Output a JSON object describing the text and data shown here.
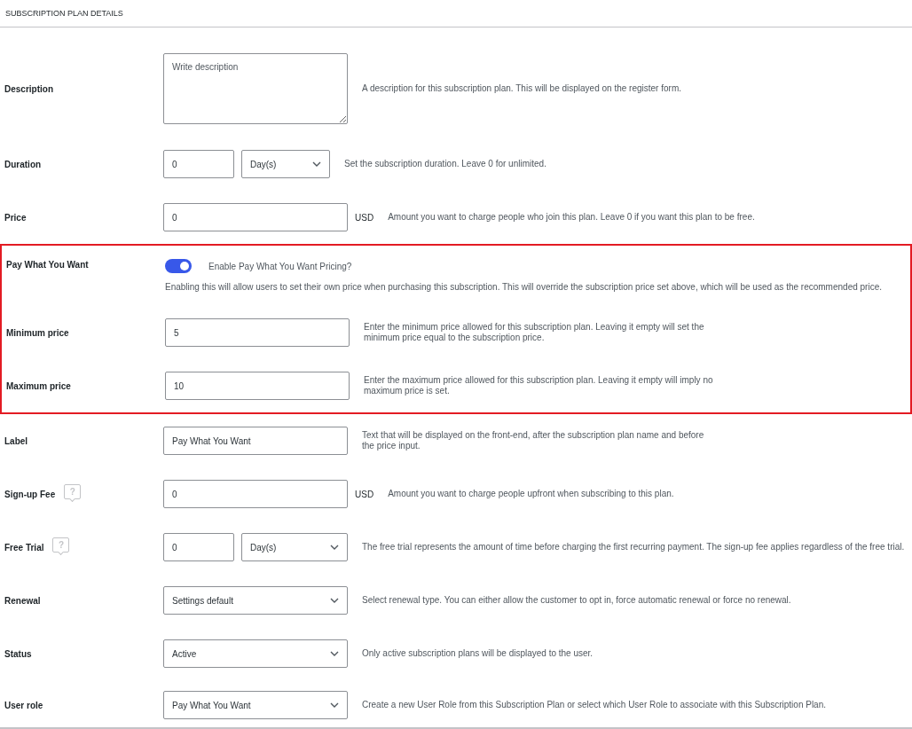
{
  "title": "SUBSCRIPTION PLAN DETAILS",
  "sections": [
    {
      "highlighted": false,
      "rows": [
        {
          "kind": "textarea",
          "label": "Description",
          "placeholder": "Write description",
          "help": "A description for this subscription plan. This will be displayed on the register form."
        },
        {
          "kind": "number_select",
          "label": "Duration",
          "value": "0",
          "select": "Day(s)",
          "help": "Set the subscription duration. Leave 0 for unlimited."
        },
        {
          "kind": "money",
          "label": "Price",
          "value": "0",
          "unit": "USD",
          "help": "Amount you want to charge people who join this plan. Leave 0 if you want this plan to be free."
        }
      ]
    },
    {
      "highlighted": true,
      "rows": [
        {
          "kind": "toggle",
          "label": "Pay What You Want",
          "on": true,
          "toggle_label": "Enable Pay What You Want Pricing?",
          "help": "Enabling this will allow users to set their own price when purchasing this subscription. This will override the subscription price set above, which will be used as the recommended price."
        },
        {
          "kind": "text",
          "label": "Minimum price",
          "value": "5",
          "help": "Enter the minimum price allowed for this subscription plan. Leaving it empty will set the minimum price equal to the subscription price."
        },
        {
          "kind": "text",
          "label": "Maximum price",
          "value": "10",
          "help": "Enter the maximum price allowed for this subscription plan. Leaving it empty will imply no maximum price is set."
        }
      ]
    },
    {
      "highlighted": false,
      "rows": [
        {
          "kind": "text",
          "label": "Label",
          "value": "Pay What You Want",
          "help": "Text that will be displayed on the front-end, after the subscription plan name and before the price input."
        },
        {
          "kind": "money",
          "label": "Sign-up Fee",
          "help_icon": "?",
          "value": "0",
          "unit": "USD",
          "help": "Amount you want to charge people upfront when subscribing to this plan."
        },
        {
          "kind": "number_select",
          "label": "Free Trial",
          "help_icon": "?",
          "value": "0",
          "select": "Day(s)",
          "help": "The free trial represents the amount of time before charging the first recurring payment. The sign-up fee applies regardless of the free trial."
        },
        {
          "kind": "select",
          "label": "Renewal",
          "value": "Settings default",
          "help": "Select renewal type. You can either allow the customer to opt in, force automatic renewal or force no renewal."
        },
        {
          "kind": "select",
          "label": "Status",
          "value": "Active",
          "help": "Only active subscription plans will be displayed to the user."
        },
        {
          "kind": "select",
          "label": "User role",
          "value": "Pay What You Want",
          "help": "Create a new User Role from this Subscription Plan or select which User Role to associate with this Subscription Plan."
        }
      ]
    }
  ]
}
